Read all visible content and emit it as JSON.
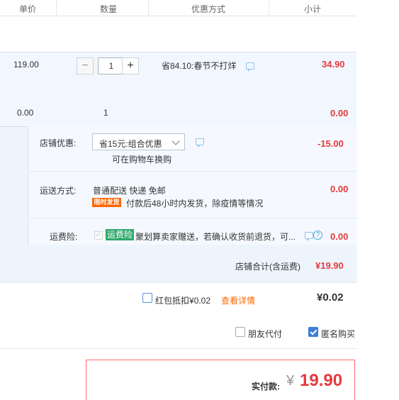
{
  "header": {
    "col_unit_price": "单价",
    "col_quantity": "数量",
    "col_discount_method": "优惠方式",
    "col_subtotal": "小计"
  },
  "item": {
    "unit_price": "119.00",
    "quantity": "1",
    "promo": "省84.10:春节不打烊",
    "subtotal": "34.90"
  },
  "gift_item": {
    "unit_price": "0.00",
    "quantity": "1",
    "subtotal": "0.00"
  },
  "shop_discount": {
    "label": "店铺优惠:",
    "selected": "省15元:组合优惠",
    "hint": "可在购物车换购",
    "amount": "-15.00"
  },
  "shipping": {
    "label": "运送方式:",
    "method": "普通配送 快递 免邮",
    "tag": "限时发货",
    "note": "付款后48小时内发货，除疫情等情况",
    "amount": "0.00"
  },
  "insurance": {
    "label": "运费险:",
    "tag": "运费险",
    "text": "聚划算卖家赠送，若确认收货前退货，可...",
    "amount": "0.00"
  },
  "shop_total": {
    "label": "店铺合计(含运费)",
    "amount": "¥19.90"
  },
  "red_packet": {
    "label": "红包抵扣¥0.02",
    "link": "查看详情",
    "amount": "¥0.02"
  },
  "options": {
    "friend_pay": "朋友代付",
    "anonymous": "匿名购买"
  },
  "payment": {
    "label": "实付款:",
    "currency": "¥",
    "amount": "19.90"
  },
  "colors": {
    "price_red": "#e4393c",
    "accent_orange": "#ff6600",
    "tag_green": "#2ea86b",
    "link_blue": "#3b7ddb"
  }
}
